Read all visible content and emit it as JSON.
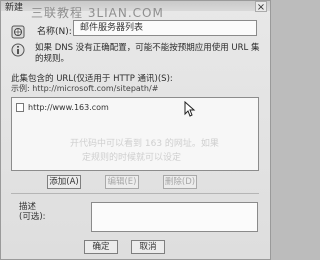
{
  "window": {
    "title": "新建",
    "watermark": "三联教程 3LIAN.COM"
  },
  "form": {
    "name_label": "名称(N):",
    "name_value": "邮件服务器列表",
    "warning_text": "如果 DNS 没有正确配置，可能不能按预期应用使用 URL 集的规则。",
    "urls_label": "此集包含的 URL(仅适用于 HTTP 通讯)(S):",
    "urls_example": "示例: http://microsoft.com/sitepath/#",
    "url_items": [
      {
        "url": "http://www.163.com"
      }
    ],
    "add_label": "添加(A)",
    "edit_label": "编辑(E)",
    "delete_label": "删除(D)",
    "desc_label_line1": "描述",
    "desc_label_line2": "(可选):",
    "ok_label": "确定",
    "cancel_label": "取消"
  },
  "icons": {
    "app": "web-page-icon",
    "warning": "info-icon",
    "cursor": "mouse-pointer-icon"
  }
}
